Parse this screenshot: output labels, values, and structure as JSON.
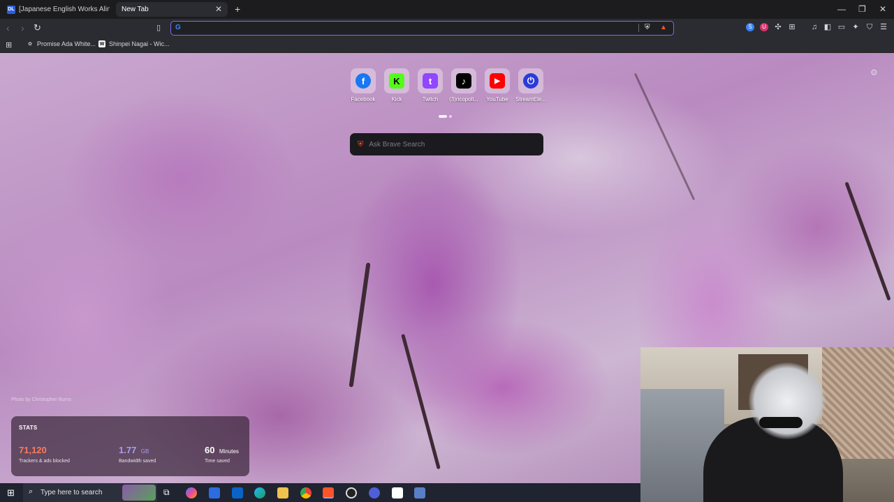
{
  "tabs": [
    {
      "favicon": "DL",
      "title": "[Japanese English Works Alingual Ra..."
    },
    {
      "title": "New Tab"
    }
  ],
  "bookmarks": [
    {
      "label": "Promise Ada White..."
    },
    {
      "label": "Shinpei Nagai - Wic..."
    }
  ],
  "address_bar": {
    "value": ""
  },
  "shortcuts": [
    {
      "label": "Facebook",
      "icon": "facebook-icon",
      "bg": "#1877f2",
      "glyph": "f"
    },
    {
      "label": "Kick",
      "icon": "kick-icon",
      "bg": "#53fc18",
      "glyph": "K"
    },
    {
      "label": "Twitch",
      "icon": "twitch-icon",
      "bg": "#9146ff",
      "glyph": "t"
    },
    {
      "label": "(3)ricopoll...",
      "icon": "tiktok-icon",
      "bg": "#000000",
      "glyph": "♪"
    },
    {
      "label": "YouTube",
      "icon": "youtube-icon",
      "bg": "#ff0000",
      "glyph": "▶"
    },
    {
      "label": "StreamEle...",
      "icon": "streamelements-icon",
      "bg": "#2b3bd8",
      "glyph": "⏻"
    }
  ],
  "search": {
    "placeholder": "Ask Brave Search"
  },
  "photo_credit": "Photo by Christopher Burns",
  "stats": {
    "title": "STATS",
    "trackers": {
      "value": "71,120",
      "label": "Trackers & ads blocked",
      "color": "#fb7b5b"
    },
    "bandwidth": {
      "value": "1.77",
      "unit": "GB",
      "label": "Bandwidth saved",
      "color": "#a99cf5"
    },
    "time": {
      "value": "60",
      "unit": "Minutes",
      "label": "Time saved",
      "color": "#ffffff"
    }
  },
  "taskbar": {
    "search_placeholder": "Type here to search"
  },
  "colors": {
    "accent": "#7b6cf0",
    "brave": "#fb542b"
  }
}
